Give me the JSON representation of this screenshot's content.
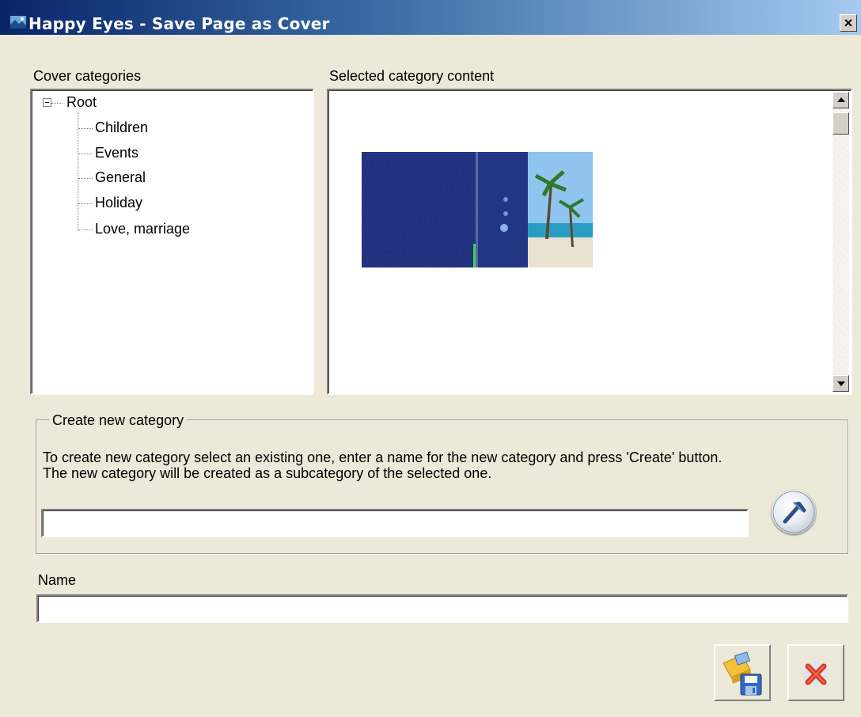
{
  "window": {
    "title": "Happy Eyes - Save Page as Cover",
    "close_label": "×"
  },
  "categories": {
    "label": "Cover categories",
    "root": "Root",
    "items": [
      "Children",
      "Events",
      "General",
      "Holiday",
      "Love, marriage"
    ]
  },
  "content": {
    "label": "Selected category content"
  },
  "create": {
    "group_label": "Create new category",
    "description": "To create new  category select an existing one, enter a name for the new category and press 'Create' button. The new category will be created as a subcategory of the selected one.",
    "input_value": ""
  },
  "name": {
    "label": "Name",
    "input_value": ""
  },
  "icons": {
    "create": "hammer-icon",
    "save": "save-icon",
    "cancel": "cancel-icon"
  },
  "colors": {
    "title_start": "#0a246a",
    "title_end": "#a6caf0",
    "dialog_bg": "#ece9d8",
    "cancel_red": "#d83a2a"
  }
}
